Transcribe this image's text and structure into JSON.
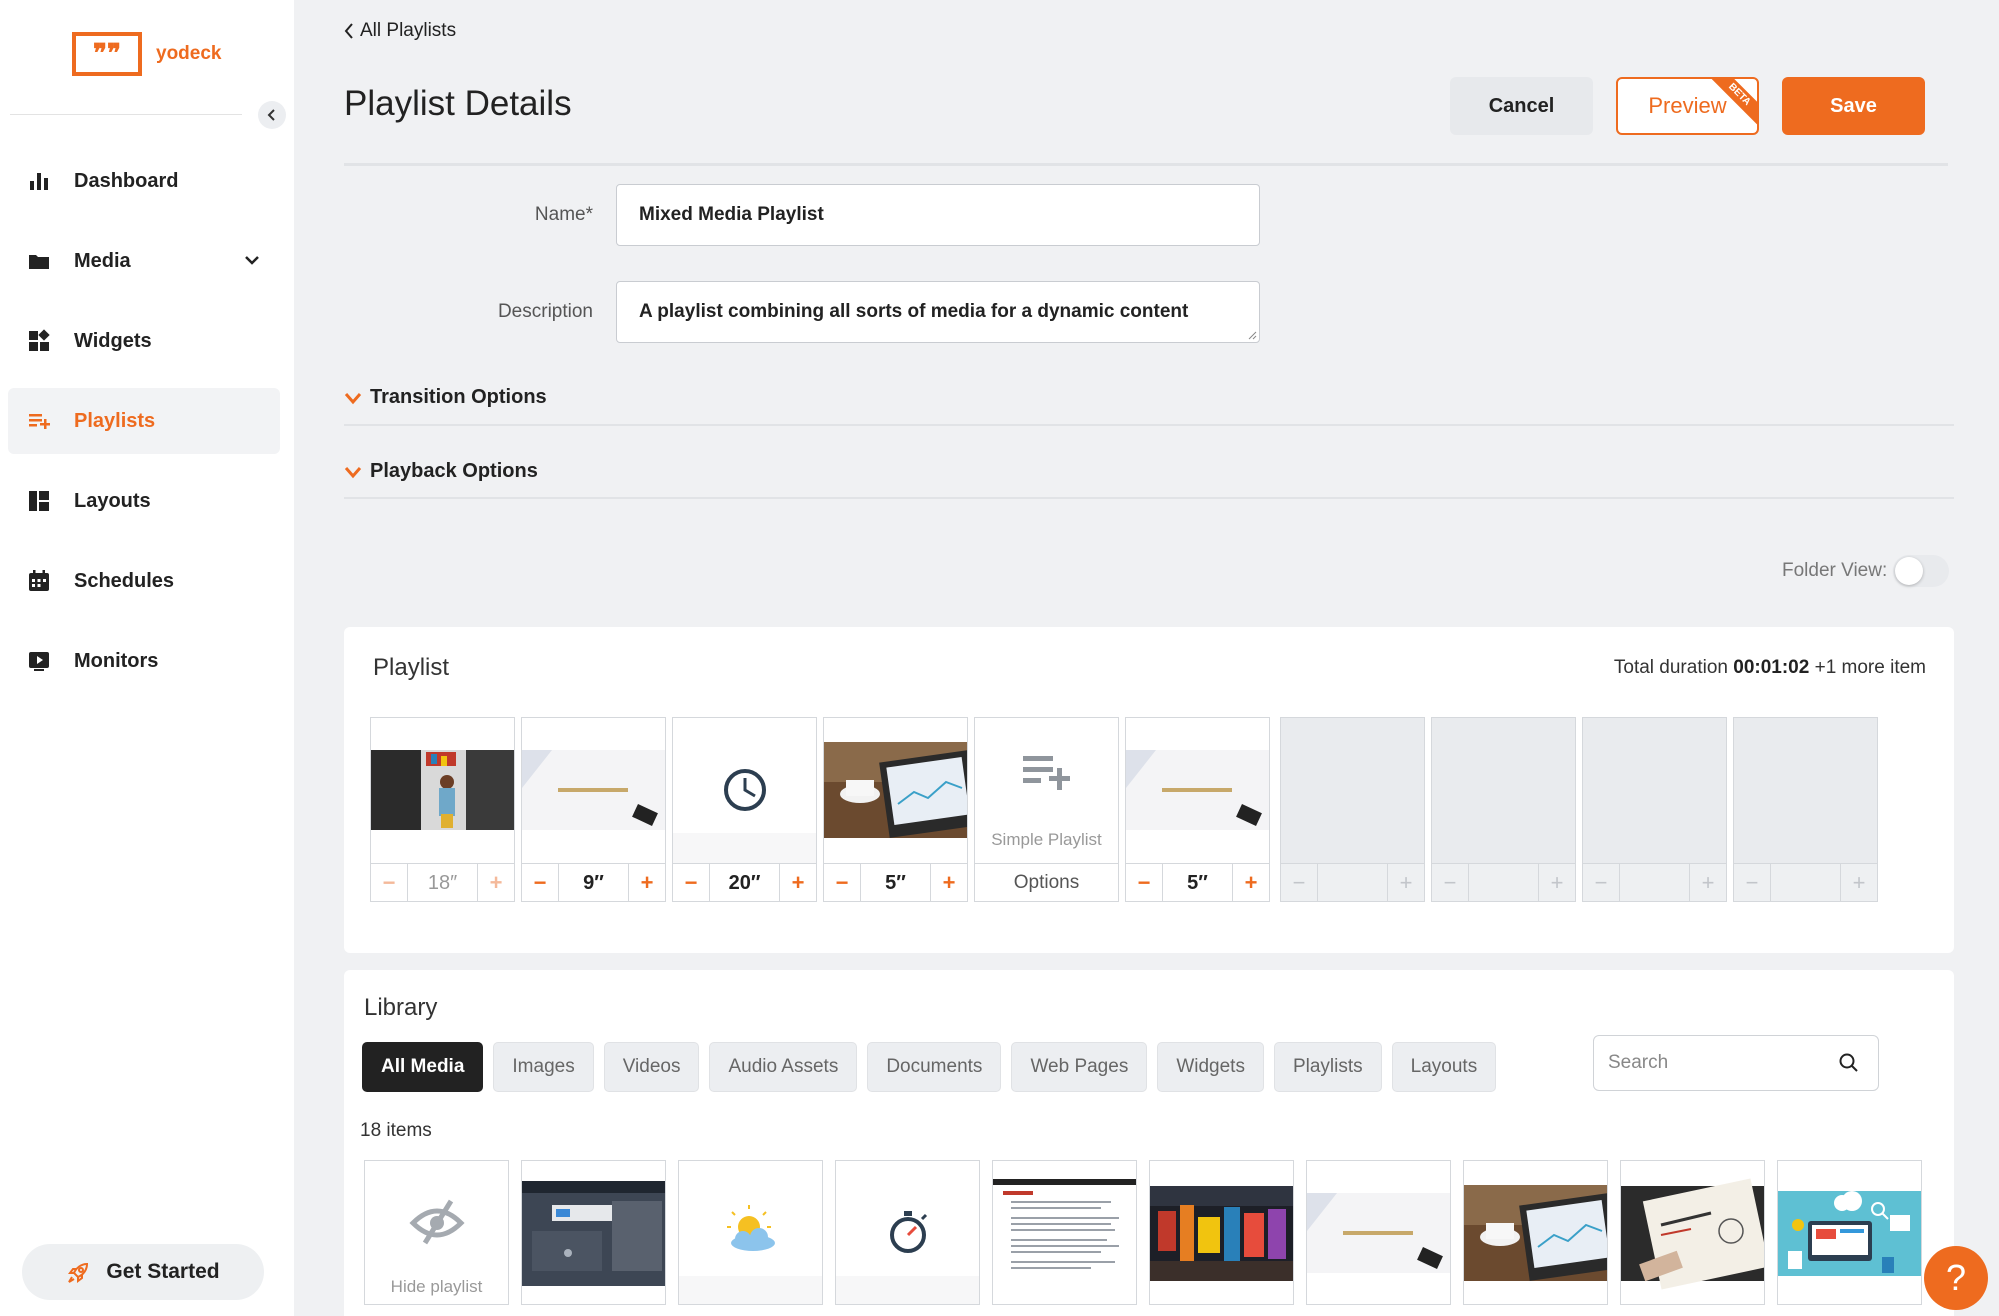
{
  "brand": {
    "name": "yodeck",
    "accent": "#ee6b1f"
  },
  "sidebar": {
    "items": [
      {
        "label": "Dashboard",
        "icon": "bar-chart-icon"
      },
      {
        "label": "Media",
        "icon": "folder-icon"
      },
      {
        "label": "Widgets",
        "icon": "widgets-icon"
      },
      {
        "label": "Playlists",
        "icon": "playlist-add-icon",
        "active": true
      },
      {
        "label": "Layouts",
        "icon": "layout-icon"
      },
      {
        "label": "Schedules",
        "icon": "calendar-icon"
      },
      {
        "label": "Monitors",
        "icon": "monitor-play-icon"
      }
    ],
    "get_started": "Get Started"
  },
  "header": {
    "back": "All Playlists",
    "title": "Playlist Details",
    "cancel": "Cancel",
    "preview": "Preview",
    "beta": "BETA",
    "save": "Save"
  },
  "form": {
    "name_label": "Name*",
    "name_value": "Mixed Media Playlist",
    "description_label": "Description",
    "description_value": "A playlist combining all sorts of media for a dynamic content"
  },
  "sections": {
    "transition": "Transition Options",
    "playback": "Playback Options"
  },
  "folder_view": {
    "label": "Folder View:",
    "on": false
  },
  "playlist": {
    "title": "Playlist",
    "total_label": "Total duration",
    "total_value": "00:01:02",
    "more": "+1 more item",
    "slots": [
      {
        "kind": "image-woman",
        "duration": "18″",
        "muted": true
      },
      {
        "kind": "image-payperclick",
        "duration": "9″"
      },
      {
        "kind": "clock",
        "duration": "20″"
      },
      {
        "kind": "image-tablet",
        "duration": "5″"
      },
      {
        "kind": "simple-playlist",
        "label": "Simple Playlist",
        "options": "Options"
      },
      {
        "kind": "image-payperclick",
        "duration": "5″"
      },
      {
        "kind": "empty"
      },
      {
        "kind": "empty"
      },
      {
        "kind": "empty"
      },
      {
        "kind": "empty"
      }
    ]
  },
  "library": {
    "title": "Library",
    "tabs": [
      "All Media",
      "Images",
      "Videos",
      "Audio Assets",
      "Documents",
      "Web Pages",
      "Widgets",
      "Playlists",
      "Layouts"
    ],
    "active_tab": "All Media",
    "search_placeholder": "Search",
    "count": "18 items",
    "hide_playlist": "Hide playlist"
  },
  "help": "?"
}
